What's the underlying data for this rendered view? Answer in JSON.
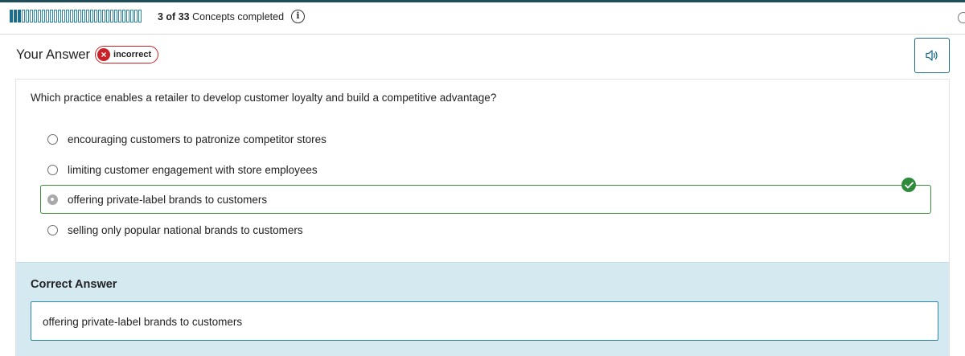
{
  "progress": {
    "completed": 3,
    "total": 33,
    "text_count": "3 of 33",
    "text_suffix": " Concepts completed"
  },
  "answer": {
    "title": "Your Answer",
    "status": "incorrect"
  },
  "question": {
    "text": "Which practice enables a retailer to develop customer loyalty and build a competitive advantage?",
    "options": [
      {
        "label": "encouraging customers to patronize competitor stores",
        "selected": false
      },
      {
        "label": "limiting customer engagement with store employees",
        "selected": false
      },
      {
        "label": "offering private-label brands to customers",
        "selected": true,
        "marked_correct": true
      },
      {
        "label": "selling only popular national brands to customers",
        "selected": false
      }
    ]
  },
  "correct_answer": {
    "title": "Correct Answer",
    "text": "offering private-label brands to customers"
  },
  "icons": {
    "info": "info-icon",
    "audio": "speaker-icon",
    "status": "x-circle-icon",
    "check": "check-circle-icon"
  },
  "colors": {
    "accent": "#1d6d8c",
    "incorrect": "#c92127",
    "correct": "#2e8b3a",
    "correct_panel_bg": "#d5eaf0"
  }
}
